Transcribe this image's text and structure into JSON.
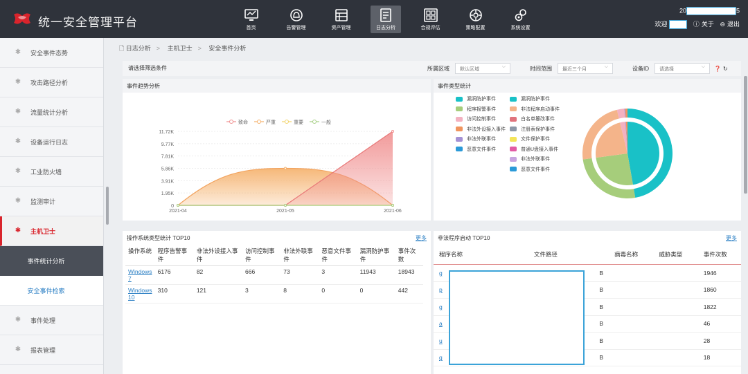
{
  "app": {
    "title": "统一安全管理平台"
  },
  "nav": [
    {
      "label": "首页",
      "icon": "monitor-icon"
    },
    {
      "label": "告警管理",
      "icon": "alarm-icon"
    },
    {
      "label": "资产管理",
      "icon": "asset-icon"
    },
    {
      "label": "日志分析",
      "icon": "log-icon"
    },
    {
      "label": "合规评估",
      "icon": "grid-icon"
    },
    {
      "label": "策略配置",
      "icon": "policy-icon"
    },
    {
      "label": "系统设置",
      "icon": "settings-icon"
    }
  ],
  "user": {
    "line1_prefix": "20",
    "line1_suffix": "5",
    "welcome": "欢迎",
    "about": "关于",
    "logout": "退出"
  },
  "sidebar": [
    {
      "label": "安全事件态势"
    },
    {
      "label": "攻击路径分析"
    },
    {
      "label": "流量统计分析"
    },
    {
      "label": "设备运行日志"
    },
    {
      "label": "工业防火墙"
    },
    {
      "label": "监测审计"
    },
    {
      "label": "主机卫士"
    },
    {
      "label": "事件统计分析"
    },
    {
      "label": "安全事件检索"
    },
    {
      "label": "事件处理"
    },
    {
      "label": "报表管理"
    }
  ],
  "breadcrumb": [
    "日志分析",
    "主机卫士",
    "安全事件分析"
  ],
  "filters": {
    "title": "请选择筛选条件",
    "region_label": "所属区域",
    "region_value": "默认区域",
    "time_label": "时间范围",
    "time_value": "最近三个月",
    "device_label": "设备ID",
    "device_placeholder": "请选择"
  },
  "trend": {
    "title": "事件趋势分析",
    "legend": [
      "致命",
      "严重",
      "重要",
      "一般"
    ]
  },
  "chart_data": [
    {
      "type": "area",
      "x": [
        "2021-04",
        "2021-05",
        "2021-06"
      ],
      "yticks": [
        "0",
        "1.95K",
        "3.91K",
        "5.86K",
        "7.81K",
        "9.77K",
        "11.72K"
      ],
      "ylim": [
        0,
        11720
      ],
      "series": [
        {
          "name": "致命",
          "values": [
            0,
            0,
            11720
          ]
        },
        {
          "name": "严重",
          "values": [
            0,
            5860,
            0
          ]
        },
        {
          "name": "重要",
          "values": [
            0,
            0,
            0
          ]
        },
        {
          "name": "一般",
          "values": [
            0,
            0,
            0
          ]
        }
      ],
      "colors": [
        "#f08f8f",
        "#f5b06a",
        "#f2d36a",
        "#a7cf86"
      ]
    },
    {
      "type": "pie",
      "title": "事件类型统计",
      "legend_col1": [
        {
          "name": "漏洞防护事件",
          "color": "#19c1c7"
        },
        {
          "name": "程序报警事件",
          "color": "#a6cd7b"
        },
        {
          "name": "访问控制事件",
          "color": "#f3b1c0"
        },
        {
          "name": "非法外设接入事件",
          "color": "#f0945e"
        },
        {
          "name": "非法外联事件",
          "color": "#a591d4"
        },
        {
          "name": "恶意文件事件",
          "color": "#2b9ad8"
        }
      ],
      "legend_col2": [
        {
          "name": "漏洞防护事件",
          "color": "#19c1c7"
        },
        {
          "name": "非法程序启动事件",
          "color": "#f4b48a"
        },
        {
          "name": "白名单篡改事件",
          "color": "#e0737c"
        },
        {
          "name": "注册表保护事件",
          "color": "#8d98a8"
        },
        {
          "name": "文件保护事件",
          "color": "#f3e45a"
        },
        {
          "name": "普通U盘接入事件",
          "color": "#e25ba4"
        },
        {
          "name": "非法外联事件",
          "color": "#c8a5e0"
        },
        {
          "name": "恶意文件事件",
          "color": "#2b9ad8"
        }
      ],
      "slices": [
        {
          "name": "漏洞防护事件",
          "value": 11943,
          "color": "#19c1c7"
        },
        {
          "name": "程序报警事件",
          "value": 6486,
          "color": "#a6cd7b"
        },
        {
          "name": "非法程序启动事件",
          "value": 5900,
          "color": "#f4b48a"
        },
        {
          "name": "访问控制事件",
          "value": 669,
          "color": "#f3b1c0"
        },
        {
          "name": "非法外联事件",
          "value": 81,
          "color": "#a591d4"
        },
        {
          "name": "非法外设接入事件",
          "value": 203,
          "color": "#f0945e"
        }
      ]
    }
  ],
  "os_table": {
    "title": "操作系统类型统计 TOP10",
    "more": "更多",
    "headers": [
      "操作系统",
      "程序告警事件",
      "非法外设接入事件",
      "访问控制事件",
      "非法外联事件",
      "恶意文件事件",
      "漏洞防护事件",
      "事件次数"
    ],
    "rows": [
      [
        "Windows 7",
        "6176",
        "82",
        "666",
        "73",
        "3",
        "11943",
        "18943"
      ],
      [
        "Windows 10",
        "310",
        "121",
        "3",
        "8",
        "0",
        "0",
        "442"
      ]
    ]
  },
  "prog_table": {
    "title": "非法程序启动 TOP10",
    "more": "更多",
    "headers": [
      "程序名称",
      "文件路径",
      "病毒名称",
      "威胁类型",
      "事件次数"
    ],
    "rows": [
      [
        "g",
        "B",
        "",
        "",
        "1946"
      ],
      [
        "p",
        "B",
        "",
        "",
        "1860"
      ],
      [
        "g",
        "B",
        "",
        "",
        "1822"
      ],
      [
        "a",
        "B",
        "",
        "",
        "46"
      ],
      [
        "u",
        "B",
        "",
        "",
        "28"
      ],
      [
        "g",
        "B",
        "",
        "",
        "18"
      ]
    ]
  }
}
